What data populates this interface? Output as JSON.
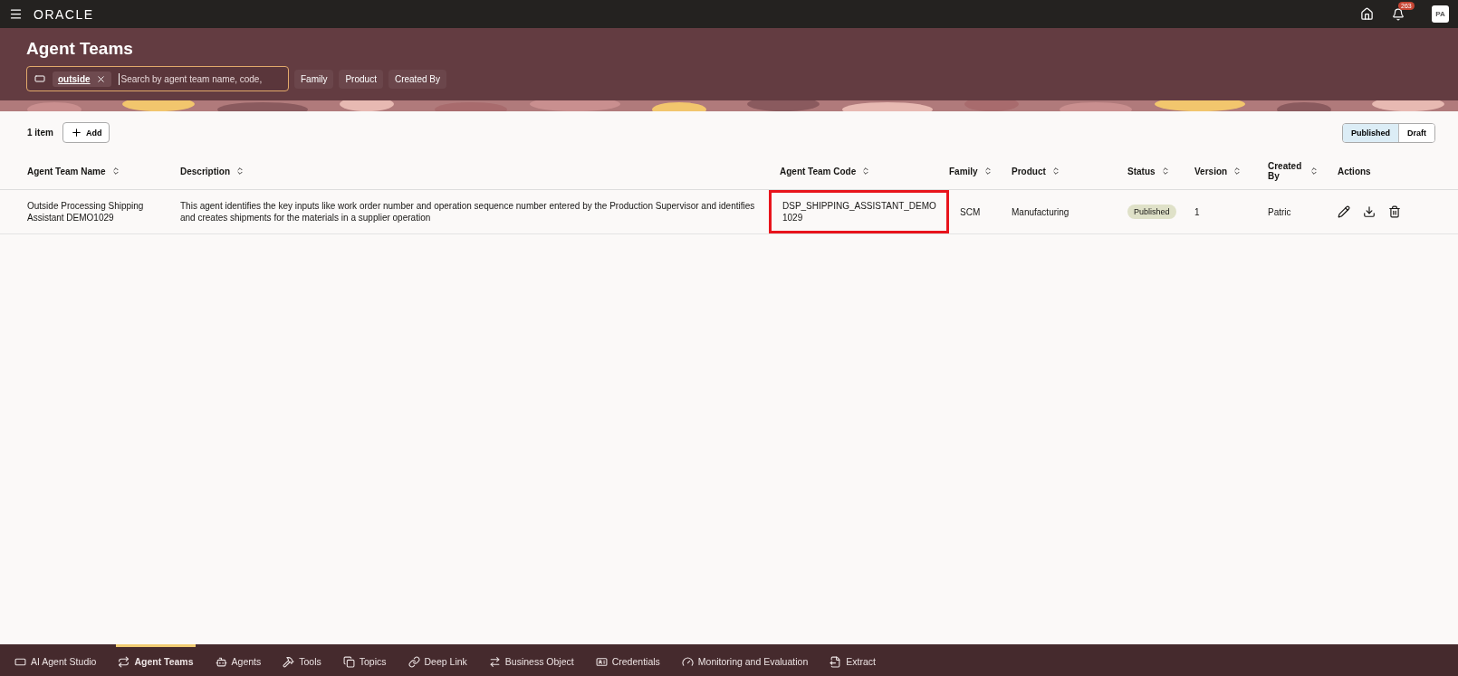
{
  "top_bar": {
    "logo": "ORACLE",
    "notifications": "263",
    "avatar": "PA"
  },
  "header": {
    "title": "Agent Teams",
    "search": {
      "chip": "outside",
      "placeholder": "Search by agent team name, code,"
    },
    "filters": [
      "Family",
      "Product",
      "Created By"
    ]
  },
  "toolbar": {
    "count": "1 item",
    "add": "Add",
    "toggle": [
      {
        "label": "Published",
        "selected": true
      },
      {
        "label": "Draft",
        "selected": false
      }
    ]
  },
  "table": {
    "columns": [
      {
        "label": "Agent Team Name",
        "sortable": true
      },
      {
        "label": "Description",
        "sortable": true
      },
      {
        "label": "Agent Team Code",
        "sortable": true
      },
      {
        "label": "Family",
        "sortable": true
      },
      {
        "label": "Product",
        "sortable": true
      },
      {
        "label": "Status",
        "sortable": true
      },
      {
        "label": "Version",
        "sortable": true
      },
      {
        "label": "Created By",
        "sortable": true
      },
      {
        "label": "Actions",
        "sortable": false
      }
    ],
    "rows": [
      {
        "name": "Outside Processing Shipping Assistant DEMO1029",
        "description": "This agent identifies the key inputs like work order number and operation sequence number entered by the Production Supervisor and identifies and creates shipments for the materials in a supplier operation",
        "code": "DSP_SHIPPING_ASSISTANT_DEMO1029",
        "code_highlighted": true,
        "family": "SCM",
        "product": "Manufacturing",
        "status": "Published",
        "version": "1",
        "created_by": "Patric"
      }
    ]
  },
  "bottom_nav": [
    {
      "label": "AI Agent Studio",
      "selected": false
    },
    {
      "label": "Agent Teams",
      "selected": true
    },
    {
      "label": "Agents",
      "selected": false
    },
    {
      "label": "Tools",
      "selected": false
    },
    {
      "label": "Topics",
      "selected": false
    },
    {
      "label": "Deep Link",
      "selected": false
    },
    {
      "label": "Business Object",
      "selected": false
    },
    {
      "label": "Credentials",
      "selected": false
    },
    {
      "label": "Monitoring and Evaluation",
      "selected": false
    },
    {
      "label": "Extract",
      "selected": false
    }
  ]
}
